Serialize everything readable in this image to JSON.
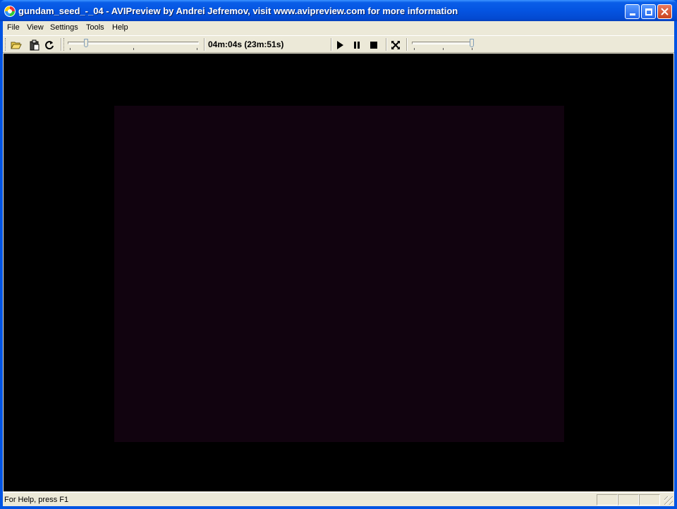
{
  "window": {
    "title": "gundam_seed_-_04 - AVIPreview  by Andrei Jefremov, visit www.avipreview.com for more information"
  },
  "menu": {
    "file": "File",
    "view": "View",
    "settings": "Settings",
    "tools": "Tools",
    "help": "Help"
  },
  "toolbar": {
    "time_readout": "04m:04s (23m:51s)",
    "seek_position": 0.13,
    "volume_level": 1.0
  },
  "statusbar": {
    "help_text": "For Help, press F1"
  },
  "colors": {
    "titlebar": "#0454e1",
    "video_background": "#000000",
    "video_frame": "#11030f",
    "chrome": "#ece9d8"
  },
  "icons": {
    "open": "folder-open-icon",
    "clipboard": "clipboard-icon",
    "refresh": "refresh-icon",
    "play": "play-icon",
    "pause": "pause-icon",
    "stop": "stop-icon",
    "fullscreen": "fullscreen-icon"
  }
}
